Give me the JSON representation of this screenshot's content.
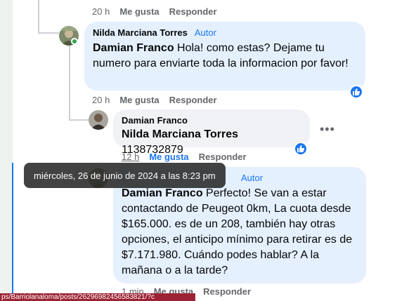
{
  "comment_top": {
    "time": "20 h",
    "like": "Me gusta",
    "reply": "Responder"
  },
  "comment_nilda": {
    "author": "Nilda Marciana Torres",
    "tag": "Autor",
    "mention": "Damian Franco",
    "text": " Hola! como estas? Dejame tu numero para enviarte toda la informacion por favor!",
    "time": "20 h",
    "like": "Me gusta",
    "reply": "Responder"
  },
  "comment_damian": {
    "author": "Damian Franco",
    "mention": "Nilda Marciana Torres",
    "text": " 1138732879",
    "time": "12 h",
    "like": "Me gusta",
    "reply": "Responder",
    "more": "•••"
  },
  "comment_nilda2": {
    "tag": "Autor",
    "mention": "Damian Franco",
    "text": " Perfecto! Se van a estar contactando de Peugeot 0km, La cuota desde $165.000. es de un 208, también hay otras opciones, el anticipo mínimo para retirar es de $7.171.980. Cuándo podes hablar? A la mañana o a la tarde?",
    "time": "1 min",
    "like": "Me gusta",
    "reply": "Responder"
  },
  "tooltip": "miércoles, 26 de junio de 2024 a las 8:23 pm",
  "status_url": "ps/Barriolanaloma/posts/26296982456583821/?c",
  "colors": {
    "accent": "#1877f2",
    "author_bubble": "#e4f0fe",
    "bubble": "#f0f2f5",
    "secondary_text": "#65676b"
  }
}
